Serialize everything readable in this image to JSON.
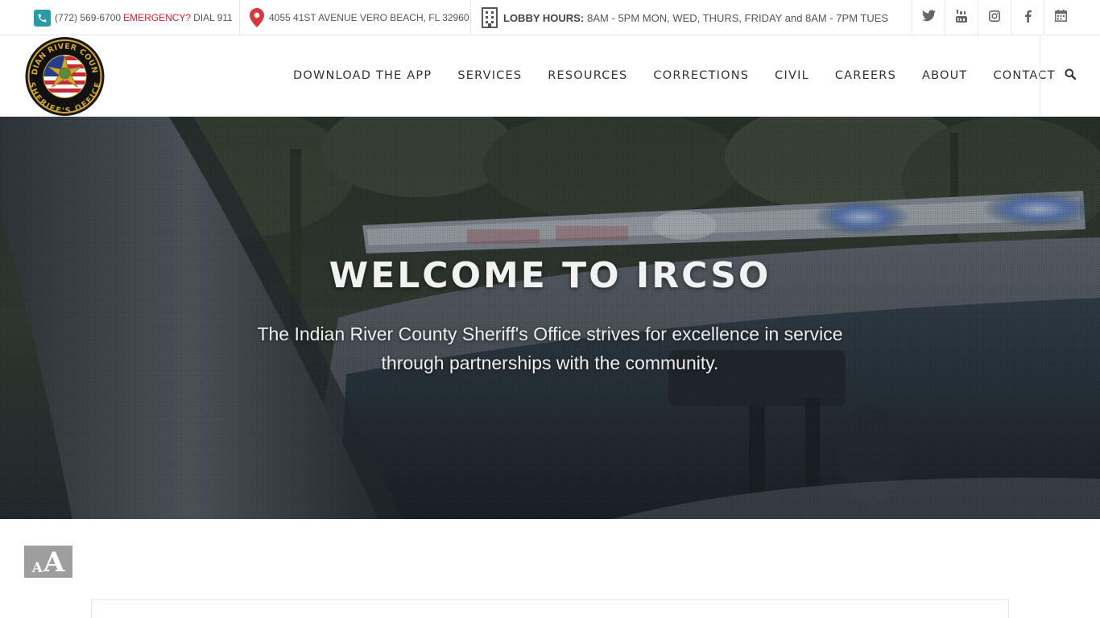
{
  "topbar": {
    "phone": "(772) 569-6700",
    "emergency_label": "EMERGENCY?",
    "emergency_text": "DIAL 911",
    "address": "4055 41ST AVENUE VERO BEACH, FL 32960",
    "hours_label": "LOBBY HOURS:",
    "hours_value": "8AM - 5PM MON, WED, THURS, FRIDAY and 8AM - 7PM TUES",
    "social_icons": [
      "twitter-icon",
      "youtube-icon",
      "instagram-icon",
      "facebook-icon",
      "calendar-icon"
    ]
  },
  "header": {
    "logo_text_top": "INDIAN RIVER COUNTY",
    "logo_text_bottom": "SHERIFF'S OFFICE",
    "nav": [
      {
        "label": "DOWNLOAD THE APP"
      },
      {
        "label": "SERVICES"
      },
      {
        "label": "RESOURCES"
      },
      {
        "label": "CORRECTIONS"
      },
      {
        "label": "CIVIL"
      },
      {
        "label": "CAREERS"
      },
      {
        "label": "ABOUT"
      },
      {
        "label": "CONTACT"
      }
    ]
  },
  "hero": {
    "title": "WELCOME TO IRCSO",
    "subtitle": "The Indian River County Sheriff's Office strives for excellence in service through partnerships with the community."
  },
  "accessibility": {
    "small_letter": "A",
    "big_letter": "A"
  },
  "colors": {
    "phone_icon_bg": "#2a9aa8",
    "emergency": "#c0272d",
    "pin": "#d9363e",
    "font_button_bg": "#9e9e9e"
  }
}
